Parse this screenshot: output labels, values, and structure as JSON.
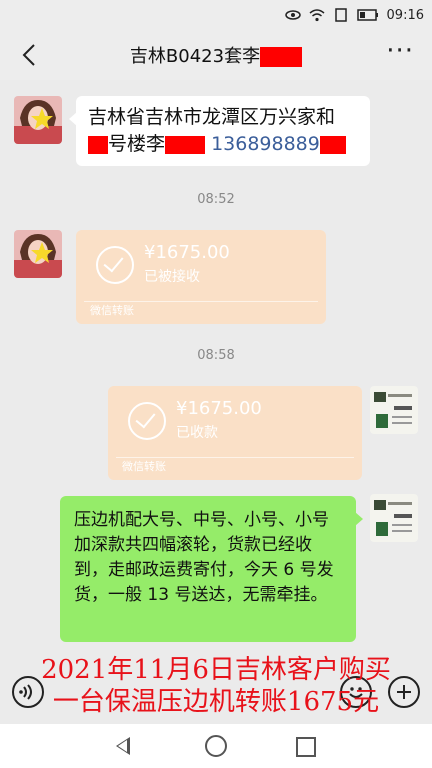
{
  "status_bar": {
    "time": "09:16"
  },
  "header": {
    "back_icon": "back-chevron-icon",
    "title": "吉林B0423套李",
    "more_label": "···"
  },
  "messages": {
    "address": {
      "line1": "吉林省吉林市龙潭区万兴家和",
      "line2_prefix": "号楼李",
      "phone": "136898889"
    },
    "time1": "08:52",
    "transfer_received_by_them": {
      "amount": "¥1675.00",
      "status": "已被接收",
      "footer": "微信转账"
    },
    "time2": "08:58",
    "transfer_collected": {
      "amount": "¥1675.00",
      "status": "已收款",
      "footer": "微信转账"
    },
    "text_message": "压边机配大号、中号、小号、小号加深款共四幅滚轮，货款已经收到，走邮政运费寄付，今天 6 号发货，一般 13 号送达，无需牵挂。"
  },
  "caption": {
    "line1": "2021年11月6日吉林客户购买",
    "line2": "一台保温压边机转账1675元"
  },
  "colors": {
    "accent_green": "#95ec69",
    "transfer_orange": "#fae0c7",
    "caption_red": "#e8121a",
    "redaction": "#ff0000"
  }
}
